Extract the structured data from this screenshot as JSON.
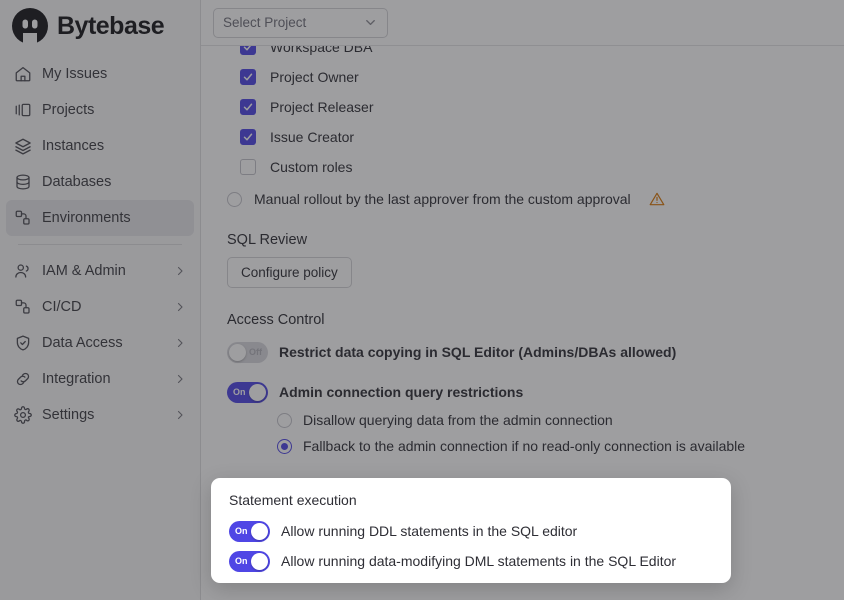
{
  "brand": {
    "name": "Bytebase",
    "logo_icon": "bytebase-logo-icon",
    "accent_color": "#4f46e5"
  },
  "sidebar": {
    "items": [
      {
        "label": "My Issues",
        "icon": "home-icon",
        "active": false,
        "chevron": false
      },
      {
        "label": "Projects",
        "icon": "projects-icon",
        "active": false,
        "chevron": false
      },
      {
        "label": "Instances",
        "icon": "layers-icon",
        "active": false,
        "chevron": false
      },
      {
        "label": "Databases",
        "icon": "database-icon",
        "active": false,
        "chevron": false
      },
      {
        "label": "Environments",
        "icon": "environments-icon",
        "active": true,
        "chevron": false
      }
    ],
    "items_lower": [
      {
        "label": "IAM & Admin",
        "icon": "users-icon",
        "active": false,
        "chevron": true
      },
      {
        "label": "CI/CD",
        "icon": "cicd-icon",
        "active": false,
        "chevron": true
      },
      {
        "label": "Data Access",
        "icon": "shield-check-icon",
        "active": false,
        "chevron": true
      },
      {
        "label": "Integration",
        "icon": "link-icon",
        "active": false,
        "chevron": true
      },
      {
        "label": "Settings",
        "icon": "gear-icon",
        "active": false,
        "chevron": true
      }
    ]
  },
  "topbar": {
    "project_select": {
      "value": "Select Project",
      "placeholder": "Select Project",
      "caret_icon": "chevron-down-icon"
    }
  },
  "main": {
    "roles": [
      {
        "label": "Workspace DBA",
        "checked": true
      },
      {
        "label": "Project Owner",
        "checked": true
      },
      {
        "label": "Project Releaser",
        "checked": true
      },
      {
        "label": "Issue Creator",
        "checked": true
      },
      {
        "label": "Custom roles",
        "checked": false
      }
    ],
    "manual_rollout": {
      "label": "Manual rollout by the last approver from the custom approval",
      "selected": false,
      "warning_icon": "warning-triangle-icon",
      "warning_color": "#d97706"
    },
    "sql_review": {
      "title": "SQL Review",
      "configure_button": "Configure policy"
    },
    "access_control": {
      "title": "Access Control",
      "restrict_copy": {
        "label": "Restrict data copying in SQL Editor (Admins/DBAs allowed)",
        "state": "Off",
        "on": false
      },
      "admin_connection": {
        "label": "Admin connection query restrictions",
        "state": "On",
        "on": true,
        "options": [
          {
            "label": "Disallow querying data from the admin connection",
            "selected": false
          },
          {
            "label": "Fallback to the admin connection if no read-only connection is available",
            "selected": true
          }
        ]
      }
    }
  },
  "modal": {
    "title": "Statement execution",
    "toggles": [
      {
        "label": "Allow running DDL statements in the SQL editor",
        "state": "On",
        "on": true
      },
      {
        "label": "Allow running data-modifying DML statements in the SQL Editor",
        "state": "On",
        "on": true
      }
    ]
  }
}
